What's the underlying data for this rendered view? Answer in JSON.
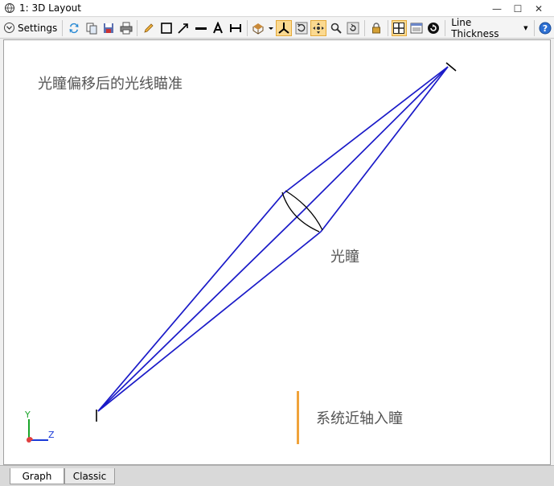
{
  "window": {
    "title": "1: 3D Layout",
    "minimize": "—",
    "maximize": "☐",
    "close": "✕"
  },
  "toolbar": {
    "settings_label": "Settings",
    "line_thickness_label": "Line Thickness",
    "icons": [
      "refresh-icon",
      "copy-icon",
      "save-icon",
      "print-icon",
      "pencil-icon",
      "rectangle-icon",
      "arrow-icon",
      "line-icon",
      "text-icon",
      "dimension-icon",
      "rotate-view-icon",
      "axes-icon",
      "rotate-icon",
      "pan-icon",
      "zoom-icon",
      "reset-view-icon",
      "lock-icon",
      "fit-view-icon",
      "window-icon",
      "cycle-icon",
      "help-icon"
    ]
  },
  "canvas": {
    "title_text": "光瞳偏移后的光线瞄准",
    "pupil_label": "光瞳",
    "paraxial_pupil_label": "系统近轴入瞳",
    "axis_y_label": "Y",
    "axis_z_label": "Z",
    "ray_color": "#1a1ac8",
    "marker_color": "#f0a33a"
  },
  "tabs": [
    {
      "label": "Graph",
      "active": true
    },
    {
      "label": "Classic",
      "active": false
    }
  ]
}
